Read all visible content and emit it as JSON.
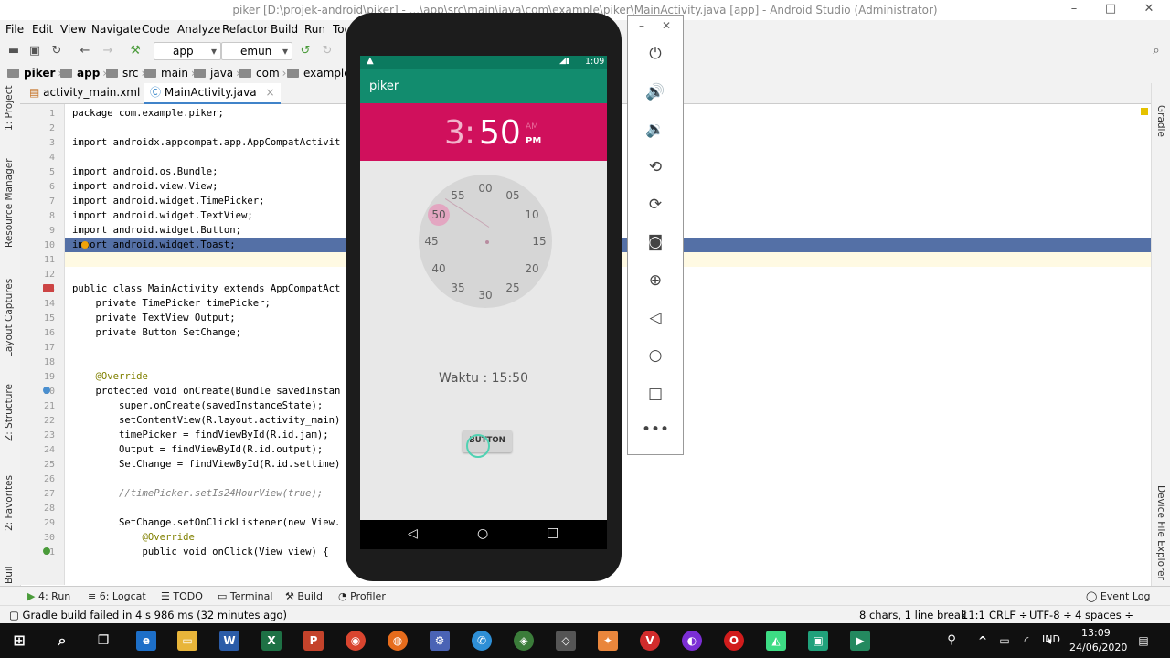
{
  "window": {
    "title": "piker [D:\\projek-android\\piker] - ...\\app\\src\\main\\java\\com\\example\\piker\\MainActivity.java [app] - Android Studio (Administrator)",
    "min": "–",
    "max": "□",
    "close": "✕"
  },
  "menu": [
    "File",
    "Edit",
    "View",
    "Navigate",
    "Code",
    "Analyze",
    "Refactor",
    "Build",
    "Run",
    "Tools"
  ],
  "toolbar": {
    "module": "app",
    "device": "emun"
  },
  "breadcrumb": [
    "piker",
    "app",
    "src",
    "main",
    "java",
    "com",
    "example"
  ],
  "left_tabs": [
    "1: Project",
    "Resource Manager",
    "Layout Captures",
    "Z: Structure",
    "2: Favorites",
    "Build Variants"
  ],
  "right_tabs": [
    "Gradle",
    "Device File Explorer"
  ],
  "editor_tabs": [
    {
      "label": "activity_main.xml",
      "active": false
    },
    {
      "label": "MainActivity.java",
      "active": true
    }
  ],
  "code_lines": [
    {
      "n": "1",
      "t": "package com.example.piker;"
    },
    {
      "n": "2",
      "t": ""
    },
    {
      "n": "3",
      "t": "import androidx.appcompat.app.AppCompatActivit"
    },
    {
      "n": "4",
      "t": ""
    },
    {
      "n": "5",
      "t": "import android.os.Bundle;"
    },
    {
      "n": "6",
      "t": "import android.view.View;"
    },
    {
      "n": "7",
      "t": "import android.widget.TimePicker;"
    },
    {
      "n": "8",
      "t": "import android.widget.TextView;"
    },
    {
      "n": "9",
      "t": "import android.widget.Button;"
    },
    {
      "n": "10",
      "t": "import android.widget.Toast;"
    },
    {
      "n": "11",
      "t": ""
    },
    {
      "n": "12",
      "t": ""
    },
    {
      "n": "13",
      "t": "public class MainActivity extends AppCompatAct"
    },
    {
      "n": "14",
      "t": "    private TimePicker timePicker;"
    },
    {
      "n": "15",
      "t": "    private TextView Output;"
    },
    {
      "n": "16",
      "t": "    private Button SetChange;"
    },
    {
      "n": "17",
      "t": ""
    },
    {
      "n": "18",
      "t": ""
    },
    {
      "n": "19",
      "t": "    @Override"
    },
    {
      "n": "20",
      "t": "    protected void onCreate(Bundle savedInstan"
    },
    {
      "n": "21",
      "t": "        super.onCreate(savedInstanceState);"
    },
    {
      "n": "22",
      "t": "        setContentView(R.layout.activity_main)"
    },
    {
      "n": "23",
      "t": "        timePicker = findViewById(R.id.jam);"
    },
    {
      "n": "24",
      "t": "        Output = findViewById(R.id.output);"
    },
    {
      "n": "25",
      "t": "        SetChange = findViewById(R.id.settime)"
    },
    {
      "n": "26",
      "t": ""
    },
    {
      "n": "27",
      "t": "        //timePicker.setIs24HourView(true);"
    },
    {
      "n": "28",
      "t": ""
    },
    {
      "n": "29",
      "t": "        SetChange.setOnClickListener(new View."
    },
    {
      "n": "30",
      "t": "            @Override"
    },
    {
      "n": "31",
      "t": "            public void onClick(View view) {"
    }
  ],
  "bottom_tabs": [
    "4: Run",
    "6: Logcat",
    "TODO",
    "Terminal",
    "Build",
    "Profiler",
    "Event Log"
  ],
  "status": {
    "message": "Gradle build failed in 4 s 986 ms (32 minutes ago)",
    "selection": "8 chars, 1 line break",
    "position": "11:1",
    "line_sep": "CRLF ÷",
    "encoding": "UTF-8 ÷",
    "indent": "4 spaces ÷"
  },
  "phone": {
    "status_time": "1:09",
    "app_title": "piker",
    "hour": "3",
    "colon": ":",
    "minute": "50",
    "am": "AM",
    "pm": "PM",
    "clock_numbers": [
      "00",
      "05",
      "10",
      "15",
      "20",
      "25",
      "30",
      "35",
      "40",
      "45",
      "50",
      "55"
    ],
    "selected_minute": "50",
    "output_text": "Waktu : 15:50",
    "button_label": "BUTTON"
  },
  "taskbar": {
    "lang": "IND",
    "time": "13:09",
    "date": "24/06/2020"
  },
  "colors": {
    "appbar": "#128c6e",
    "time_header": "#d0105c",
    "selection_bar": "#5470a6"
  }
}
